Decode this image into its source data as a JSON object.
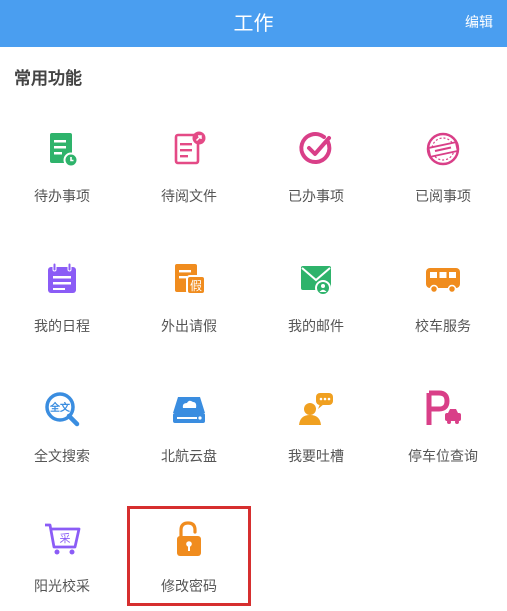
{
  "header": {
    "title": "工作",
    "edit_label": "编辑",
    "color": "#4a9ef0"
  },
  "section": {
    "title": "常用功能"
  },
  "tiles": [
    {
      "label": "待办事项",
      "icon": "todo-doc-icon",
      "color": "#2eb36b"
    },
    {
      "label": "待阅文件",
      "icon": "read-doc-icon",
      "color": "#e44a86"
    },
    {
      "label": "已办事项",
      "icon": "check-circle-icon",
      "color": "#d93f88"
    },
    {
      "label": "已阅事项",
      "icon": "read-stamp-icon",
      "color": "#d93f88"
    },
    {
      "label": "我的日程",
      "icon": "calendar-icon",
      "color": "#8b5cf6"
    },
    {
      "label": "外出请假",
      "icon": "leave-doc-icon",
      "color": "#f08c1e"
    },
    {
      "label": "我的邮件",
      "icon": "mail-icon",
      "color": "#2eb36b"
    },
    {
      "label": "校车服务",
      "icon": "bus-icon",
      "color": "#f08c1e"
    },
    {
      "label": "全文搜索",
      "icon": "search-icon",
      "color": "#3a8de0"
    },
    {
      "label": "北航云盘",
      "icon": "cloud-drive-icon",
      "color": "#3a8de0"
    },
    {
      "label": "我要吐槽",
      "icon": "comment-icon",
      "color": "#f0a020"
    },
    {
      "label": "停车位查询",
      "icon": "parking-icon",
      "color": "#d93f88"
    },
    {
      "label": "阳光校采",
      "icon": "cart-icon",
      "color": "#8b5cf6"
    },
    {
      "label": "修改密码",
      "icon": "unlock-icon",
      "color": "#f08c1e"
    }
  ]
}
